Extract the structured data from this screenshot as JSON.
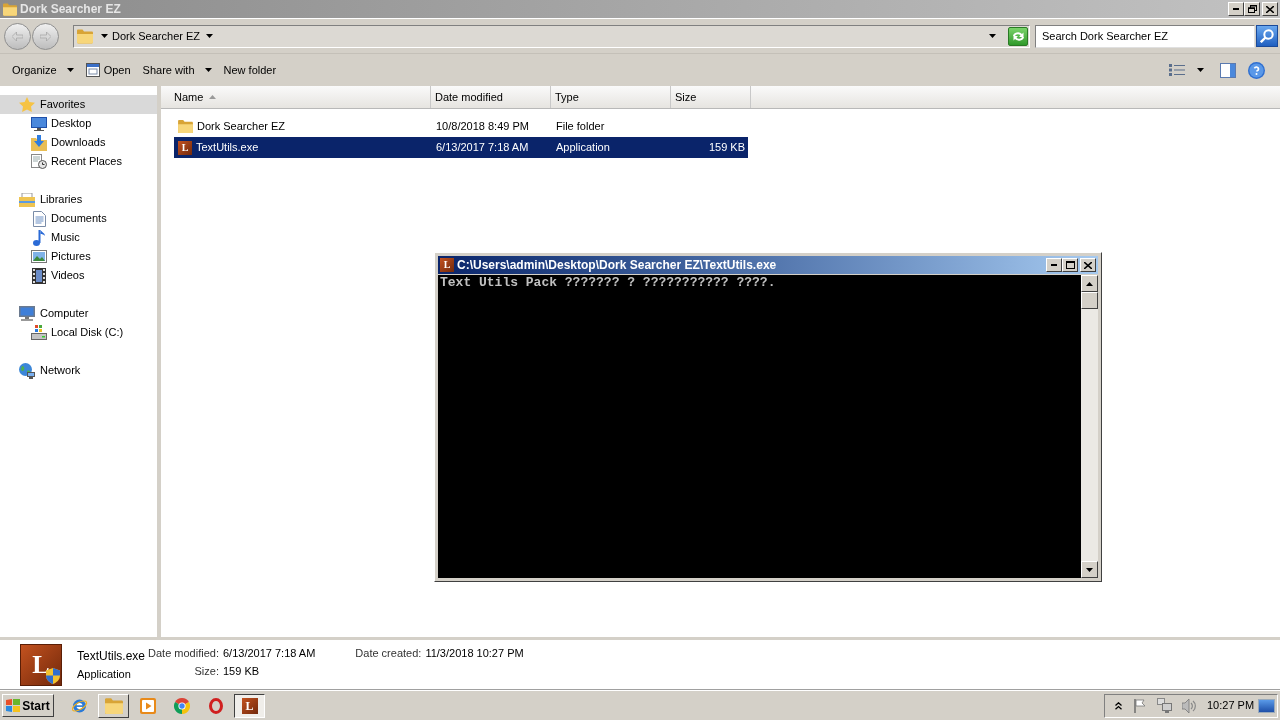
{
  "window": {
    "title": "Dork Searcher EZ"
  },
  "address_bar": {
    "segments": [
      "Dork Searcher EZ"
    ]
  },
  "search": {
    "placeholder": "Search Dork Searcher EZ"
  },
  "toolbar": {
    "items": [
      {
        "label": "Organize",
        "kind": "menu"
      },
      {
        "label": "Open",
        "kind": "open"
      },
      {
        "label": "Share with",
        "kind": "menu"
      },
      {
        "label": "New folder",
        "kind": "plain"
      }
    ]
  },
  "sidebar": {
    "groups": [
      {
        "label": "Favorites",
        "kind": "star",
        "selected": true,
        "children": [
          {
            "label": "Desktop",
            "kind": "desktop",
            "selected": false
          },
          {
            "label": "Downloads",
            "kind": "downloads",
            "selected": false
          },
          {
            "label": "Recent Places",
            "kind": "recent",
            "selected": false
          }
        ]
      },
      {
        "label": "Libraries",
        "kind": "library",
        "selected": false,
        "children": [
          {
            "label": "Documents",
            "kind": "documents",
            "selected": false
          },
          {
            "label": "Music",
            "kind": "music",
            "selected": false
          },
          {
            "label": "Pictures",
            "kind": "pictures",
            "selected": false
          },
          {
            "label": "Videos",
            "kind": "videos",
            "selected": false
          }
        ]
      },
      {
        "label": "Computer",
        "kind": "computer",
        "selected": false,
        "children": [
          {
            "label": "Local Disk (C:)",
            "kind": "disk",
            "selected": false
          }
        ]
      },
      {
        "label": "Network",
        "kind": "network",
        "selected": false
      }
    ]
  },
  "file_list": {
    "columns": [
      {
        "label": "Name",
        "sorted": true
      },
      {
        "label": "Date modified",
        "sorted": false
      },
      {
        "label": "Type",
        "sorted": false
      },
      {
        "label": "Size",
        "sorted": false
      }
    ],
    "rows": [
      {
        "name": "Dork Searcher EZ",
        "kind": "folder",
        "date_modified": "10/8/2018 8:49 PM",
        "type": "File folder",
        "selected": false
      },
      {
        "name": "TextUtils.exe",
        "kind": "app",
        "icon_letter": "L",
        "date_modified": "6/13/2017 7:18 AM",
        "type": "Application",
        "size": "159 KB",
        "selected": true
      }
    ]
  },
  "console": {
    "title": "C:\\Users\\admin\\Desktop\\Dork Searcher EZ\\TextUtils.exe",
    "icon_letter": "L",
    "lines": [
      "Text Utils Pack ??????? ? ??????????? ????."
    ]
  },
  "details": {
    "name": "TextUtils.exe",
    "type": "Application",
    "icon_letter": "L",
    "fields": [
      {
        "label": "Date modified:",
        "value": "6/13/2017 7:18 AM"
      },
      {
        "label": "Size:",
        "value": "159 KB"
      },
      {
        "label": "Date created:",
        "value": "11/3/2018 10:27 PM"
      }
    ]
  },
  "taskbar": {
    "start": "Start",
    "items": [
      {
        "kind": "ie",
        "running": false,
        "selected": false
      },
      {
        "kind": "explorer",
        "running": true,
        "selected": false
      },
      {
        "kind": "media",
        "running": false,
        "selected": false
      },
      {
        "kind": "chrome",
        "running": false,
        "selected": false
      },
      {
        "kind": "opera",
        "running": false,
        "selected": false
      },
      {
        "kind": "app",
        "icon_letter": "L",
        "running": true,
        "selected": true
      }
    ],
    "clock": "10:27 PM"
  }
}
